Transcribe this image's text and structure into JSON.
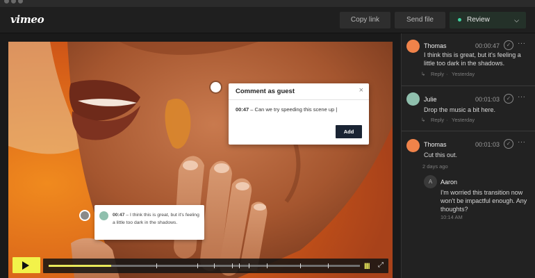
{
  "app": {
    "logo": "vimeo"
  },
  "toolbar": {
    "copy_link": "Copy link",
    "send_file": "Send file",
    "review": "Review",
    "review_chevron": "chevron-down-icon"
  },
  "player": {
    "progress_fraction": 0.2,
    "play_icon": "play-icon",
    "volume_icon": "volume-icon",
    "fullscreen_icon": "fullscreen-icon"
  },
  "comment_popup": {
    "title": "Comment as guest",
    "close": "×",
    "timestamp": "00:47",
    "text": " – Can we try speeding this scene up",
    "add_label": "Add"
  },
  "video_comment": {
    "timestamp": "00:47",
    "text": " – I think this is great, but it's feeling a little too dark in the shadows."
  },
  "comments": [
    {
      "name": "Thomas",
      "time": "00:00:47",
      "text": "I think this is great, but it's feeling a little too dark in the shadows.",
      "reply": "Reply",
      "date": "Yesterday",
      "color": "#f0834a"
    },
    {
      "name": "Julie",
      "time": "00:01:03",
      "text": "Drop the music a bit here.",
      "reply": "Reply",
      "date": "Yesterday",
      "color": "#8fbfad"
    },
    {
      "name": "Thomas",
      "time": "00:01:03",
      "text": "Cut this out.",
      "date": "2 days ago",
      "color": "#f0834a",
      "reply_item": {
        "initial": "A",
        "name": "Aaron",
        "text": "I'm worried this transition now won't be impactful enough. Any thoughts?",
        "time": "10:14 AM"
      }
    }
  ]
}
